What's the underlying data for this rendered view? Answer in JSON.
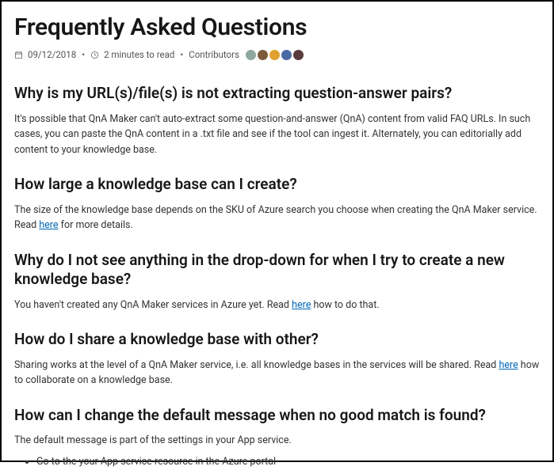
{
  "page": {
    "title": "Frequently Asked Questions",
    "meta": {
      "date": "09/12/2018",
      "read_time": "2 minutes to read",
      "contributors_label": "Contributors"
    }
  },
  "contributors": {
    "colors": [
      "#8ea8a0",
      "#7d5a3c",
      "#e0a030",
      "#4a6aa5",
      "#5a3c3c"
    ]
  },
  "faq": [
    {
      "q": "Why is my URL(s)/file(s) is not extracting question-answer pairs?",
      "a_pre": "It's possible that QnA Maker can't auto-extract some question-and-answer (QnA) content from valid FAQ URLs. In such cases, you can paste the QnA content in a .txt file and see if the tool can ingest it. Alternately, you can editorially add content to your knowledge base.",
      "link": null,
      "a_post": ""
    },
    {
      "q": "How large a knowledge base can I create?",
      "a_pre": "The size of the knowledge base depends on the SKU of Azure search you choose when creating the QnA Maker service. Read ",
      "link": "here",
      "a_post": " for more details."
    },
    {
      "q": "Why do I not see anything in the drop-down for when I try to create a new knowledge base?",
      "a_pre": "You haven't created any QnA Maker services in Azure yet. Read ",
      "link": "here",
      "a_post": " how to do that."
    },
    {
      "q": "How do I share a knowledge base with other?",
      "a_pre": "Sharing works at the level of a QnA Maker service, i.e. all knowledge bases in the services will be shared. Read ",
      "link": "here",
      "a_post": " how to collaborate on a knowledge base."
    },
    {
      "q": "How can I change the default message when no good match is found?",
      "a_pre": "The default message is part of the settings in your App service.",
      "link": null,
      "a_post": "",
      "bullets": [
        "Go to the your App service resource in the Azure portal"
      ]
    }
  ]
}
